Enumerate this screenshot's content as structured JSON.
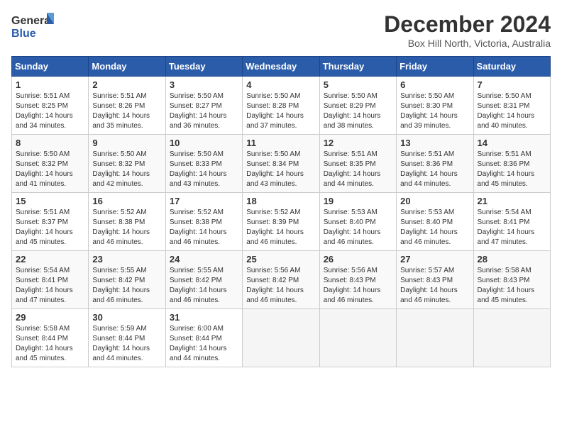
{
  "logo": {
    "line1": "General",
    "line2": "Blue"
  },
  "title": "December 2024",
  "subtitle": "Box Hill North, Victoria, Australia",
  "days_header": [
    "Sunday",
    "Monday",
    "Tuesday",
    "Wednesday",
    "Thursday",
    "Friday",
    "Saturday"
  ],
  "weeks": [
    [
      {
        "num": "1",
        "info": "Sunrise: 5:51 AM\nSunset: 8:25 PM\nDaylight: 14 hours\nand 34 minutes."
      },
      {
        "num": "2",
        "info": "Sunrise: 5:51 AM\nSunset: 8:26 PM\nDaylight: 14 hours\nand 35 minutes."
      },
      {
        "num": "3",
        "info": "Sunrise: 5:50 AM\nSunset: 8:27 PM\nDaylight: 14 hours\nand 36 minutes."
      },
      {
        "num": "4",
        "info": "Sunrise: 5:50 AM\nSunset: 8:28 PM\nDaylight: 14 hours\nand 37 minutes."
      },
      {
        "num": "5",
        "info": "Sunrise: 5:50 AM\nSunset: 8:29 PM\nDaylight: 14 hours\nand 38 minutes."
      },
      {
        "num": "6",
        "info": "Sunrise: 5:50 AM\nSunset: 8:30 PM\nDaylight: 14 hours\nand 39 minutes."
      },
      {
        "num": "7",
        "info": "Sunrise: 5:50 AM\nSunset: 8:31 PM\nDaylight: 14 hours\nand 40 minutes."
      }
    ],
    [
      {
        "num": "8",
        "info": "Sunrise: 5:50 AM\nSunset: 8:32 PM\nDaylight: 14 hours\nand 41 minutes."
      },
      {
        "num": "9",
        "info": "Sunrise: 5:50 AM\nSunset: 8:32 PM\nDaylight: 14 hours\nand 42 minutes."
      },
      {
        "num": "10",
        "info": "Sunrise: 5:50 AM\nSunset: 8:33 PM\nDaylight: 14 hours\nand 43 minutes."
      },
      {
        "num": "11",
        "info": "Sunrise: 5:50 AM\nSunset: 8:34 PM\nDaylight: 14 hours\nand 43 minutes."
      },
      {
        "num": "12",
        "info": "Sunrise: 5:51 AM\nSunset: 8:35 PM\nDaylight: 14 hours\nand 44 minutes."
      },
      {
        "num": "13",
        "info": "Sunrise: 5:51 AM\nSunset: 8:36 PM\nDaylight: 14 hours\nand 44 minutes."
      },
      {
        "num": "14",
        "info": "Sunrise: 5:51 AM\nSunset: 8:36 PM\nDaylight: 14 hours\nand 45 minutes."
      }
    ],
    [
      {
        "num": "15",
        "info": "Sunrise: 5:51 AM\nSunset: 8:37 PM\nDaylight: 14 hours\nand 45 minutes."
      },
      {
        "num": "16",
        "info": "Sunrise: 5:52 AM\nSunset: 8:38 PM\nDaylight: 14 hours\nand 46 minutes."
      },
      {
        "num": "17",
        "info": "Sunrise: 5:52 AM\nSunset: 8:38 PM\nDaylight: 14 hours\nand 46 minutes."
      },
      {
        "num": "18",
        "info": "Sunrise: 5:52 AM\nSunset: 8:39 PM\nDaylight: 14 hours\nand 46 minutes."
      },
      {
        "num": "19",
        "info": "Sunrise: 5:53 AM\nSunset: 8:40 PM\nDaylight: 14 hours\nand 46 minutes."
      },
      {
        "num": "20",
        "info": "Sunrise: 5:53 AM\nSunset: 8:40 PM\nDaylight: 14 hours\nand 46 minutes."
      },
      {
        "num": "21",
        "info": "Sunrise: 5:54 AM\nSunset: 8:41 PM\nDaylight: 14 hours\nand 47 minutes."
      }
    ],
    [
      {
        "num": "22",
        "info": "Sunrise: 5:54 AM\nSunset: 8:41 PM\nDaylight: 14 hours\nand 47 minutes."
      },
      {
        "num": "23",
        "info": "Sunrise: 5:55 AM\nSunset: 8:42 PM\nDaylight: 14 hours\nand 46 minutes."
      },
      {
        "num": "24",
        "info": "Sunrise: 5:55 AM\nSunset: 8:42 PM\nDaylight: 14 hours\nand 46 minutes."
      },
      {
        "num": "25",
        "info": "Sunrise: 5:56 AM\nSunset: 8:42 PM\nDaylight: 14 hours\nand 46 minutes."
      },
      {
        "num": "26",
        "info": "Sunrise: 5:56 AM\nSunset: 8:43 PM\nDaylight: 14 hours\nand 46 minutes."
      },
      {
        "num": "27",
        "info": "Sunrise: 5:57 AM\nSunset: 8:43 PM\nDaylight: 14 hours\nand 46 minutes."
      },
      {
        "num": "28",
        "info": "Sunrise: 5:58 AM\nSunset: 8:43 PM\nDaylight: 14 hours\nand 45 minutes."
      }
    ],
    [
      {
        "num": "29",
        "info": "Sunrise: 5:58 AM\nSunset: 8:44 PM\nDaylight: 14 hours\nand 45 minutes."
      },
      {
        "num": "30",
        "info": "Sunrise: 5:59 AM\nSunset: 8:44 PM\nDaylight: 14 hours\nand 44 minutes."
      },
      {
        "num": "31",
        "info": "Sunrise: 6:00 AM\nSunset: 8:44 PM\nDaylight: 14 hours\nand 44 minutes."
      },
      null,
      null,
      null,
      null
    ]
  ]
}
